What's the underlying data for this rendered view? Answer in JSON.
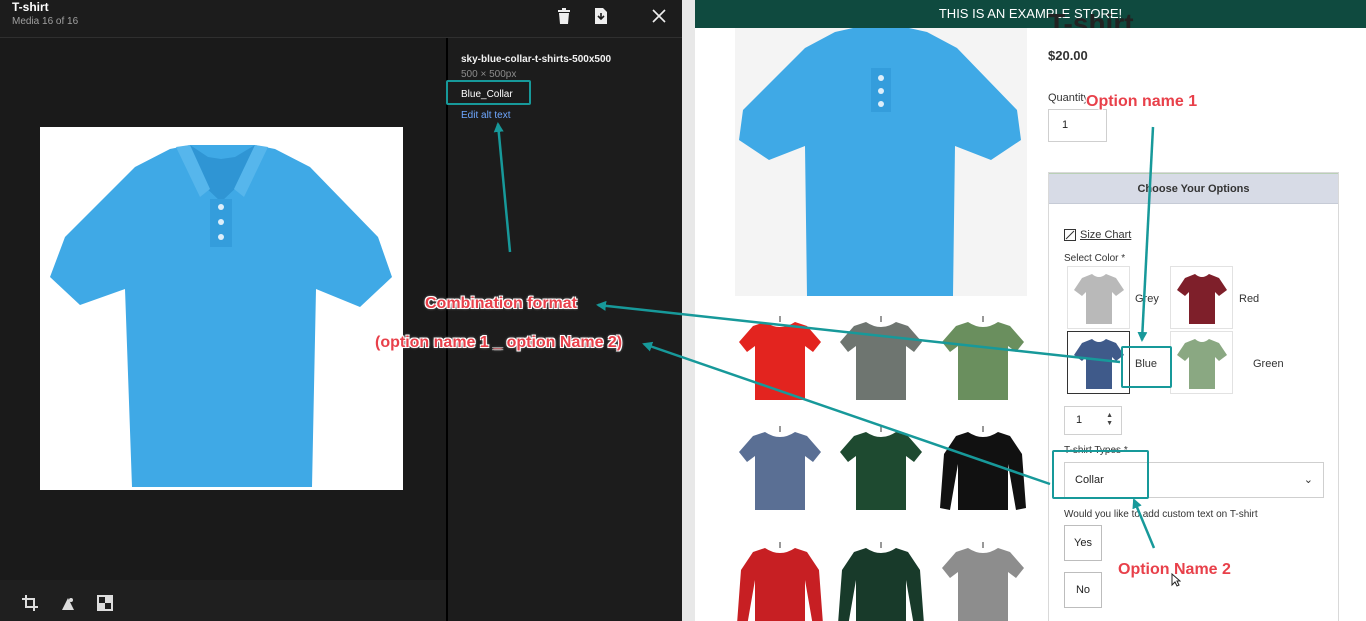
{
  "media_panel": {
    "title": "T-shirt",
    "count": "Media 16 of 16",
    "file_name": "sky-blue-collar-t-shirts-500x500",
    "dimensions": "500 × 500px",
    "alt_text": "Blue_Collar",
    "edit_alt_link": "Edit alt text",
    "header_icons": [
      "trash-icon",
      "download-icon",
      "close-icon"
    ],
    "toolbar_icons": [
      "crop-icon",
      "focal-point-icon",
      "replace-icon"
    ]
  },
  "store": {
    "banner": "THIS IS AN EXAMPLE STORE!",
    "product_title": "T-shirt",
    "price": "$20.00",
    "quantity_label": "Quantity",
    "quantity_value": "1",
    "options_header": "Choose Your Options",
    "size_chart_link": "Size Chart",
    "select_color_label": "Select Color *",
    "colors": [
      {
        "label": "Grey",
        "color": "#b9b9b9"
      },
      {
        "label": "Red",
        "color": "#7e1f2a"
      },
      {
        "label": "Blue",
        "color": "#3f5a8a"
      },
      {
        "label": "Green",
        "color": "#8aa882"
      }
    ],
    "stepper_value": "1",
    "tshirt_types_label": "T-shirt Types *",
    "tshirt_type_selected": "Collar",
    "custom_text_label": "Would you like to add custom text on T-shirt",
    "yes_label": "Yes",
    "no_label": "No",
    "thumbnails": [
      {
        "color": "#e3241f",
        "style": "tee"
      },
      {
        "color": "#6e7570",
        "style": "tee"
      },
      {
        "color": "#6a8f5e",
        "style": "tee"
      },
      {
        "color": "#5a6f94",
        "style": "tee"
      },
      {
        "color": "#1e4a30",
        "style": "polo"
      },
      {
        "color": "#111111",
        "style": "long"
      },
      {
        "color": "#c71f23",
        "style": "long"
      },
      {
        "color": "#183a2a",
        "style": "long"
      },
      {
        "color": "#8d8d8d",
        "style": "polo"
      }
    ]
  },
  "annotations": {
    "option_name_1": "Option name 1",
    "option_name_2": "Option Name 2",
    "combination_format": "Combination format",
    "combination_example": "(option name 1 _ option Name 2)",
    "accent_color": "#17999a",
    "callout_color": "#e8404a"
  }
}
